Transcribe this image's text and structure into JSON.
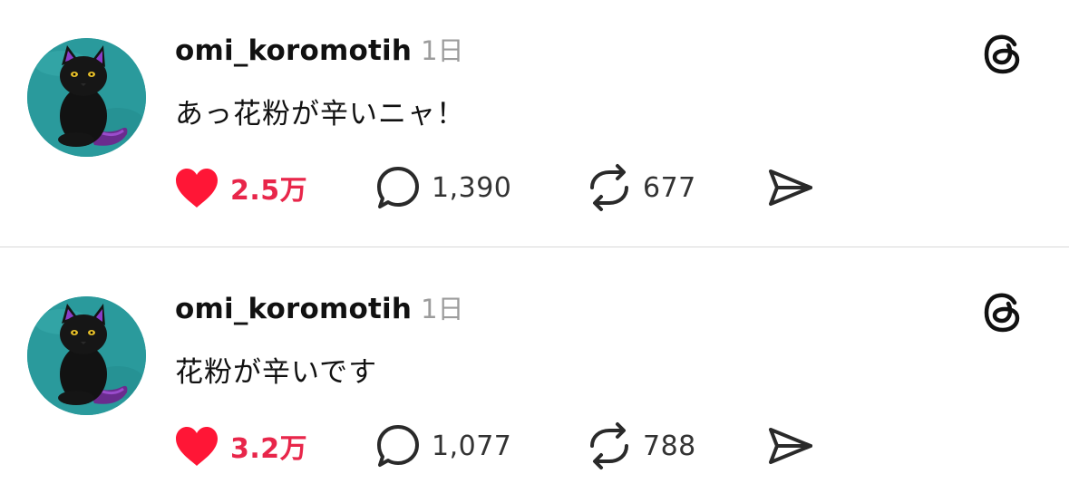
{
  "posts": [
    {
      "username": "omi_koromotih",
      "time": "1日",
      "text": "あっ花粉が辛いニャ！",
      "likes": "2.5万",
      "replies": "1,390",
      "reposts": "677"
    },
    {
      "username": "omi_koromotih",
      "time": "1日",
      "text": "花粉が辛いです",
      "likes": "3.2万",
      "replies": "1,077",
      "reposts": "788"
    }
  ],
  "icons": {
    "app": "threads-logo-icon",
    "like": "heart-icon",
    "reply": "speech-bubble-icon",
    "repost": "repost-icon",
    "share": "send-icon"
  },
  "colors": {
    "like_active": "#e8264a",
    "avatar_bg": "#2a9a9c",
    "username": "#111111",
    "time": "#9c9c9c",
    "divider": "#d8d8d8"
  }
}
